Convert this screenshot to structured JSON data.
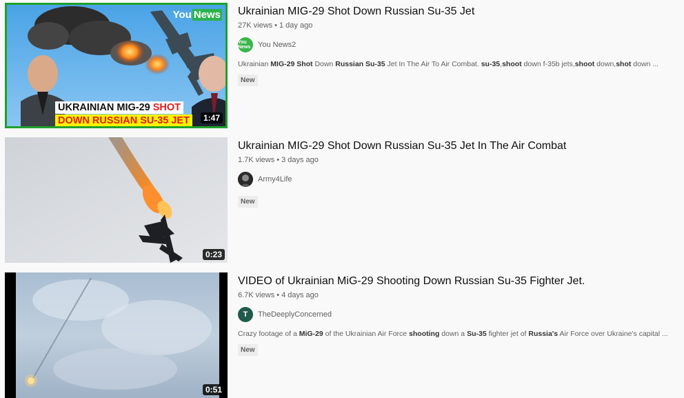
{
  "results": [
    {
      "title": "Ukrainian MIG-29 Shot Down Russian Su-35 Jet",
      "views": "27K views",
      "age": "1 day ago",
      "channel": "You News2",
      "avatar_text": "You News",
      "desc": {
        "parts": [
          {
            "text": "Ukrainian ",
            "bold": false
          },
          {
            "text": "MIG-29 Shot",
            "bold": true
          },
          {
            "text": " Down ",
            "bold": false
          },
          {
            "text": "Russian Su-35",
            "bold": true
          },
          {
            "text": " Jet In The Air To Air Combat. ",
            "bold": false
          },
          {
            "text": "su-35",
            "bold": true
          },
          {
            "text": ",",
            "bold": false
          },
          {
            "text": "shoot",
            "bold": true
          },
          {
            "text": " down f-35b jets,",
            "bold": false
          },
          {
            "text": "shoot",
            "bold": true
          },
          {
            "text": " down,",
            "bold": false
          },
          {
            "text": "shot",
            "bold": true
          },
          {
            "text": " down ...",
            "bold": false
          }
        ]
      },
      "badge": "New",
      "duration": "1:47",
      "thumb_logo_you": "You",
      "thumb_logo_news": "News",
      "thumb_line1_a": "UKRAINIAN MIG-29 ",
      "thumb_line1_b": "SHOT",
      "thumb_line2": "DOWN RUSSIAN SU-35 JET"
    },
    {
      "title": "Ukrainian MIG-29 Shot Down Russian Su-35 Jet In The Air Combat",
      "views": "1.7K views",
      "age": "3 days ago",
      "channel": "Army4Life",
      "badge": "New",
      "duration": "0:23"
    },
    {
      "title": "VIDEO of Ukrainian MiG-29 Shooting Down Russian Su-35 Fighter Jet.",
      "views": "6.7K views",
      "age": "4 days ago",
      "channel": "TheDeeplyConcerned",
      "avatar_text": "T",
      "desc": {
        "parts": [
          {
            "text": "Crazy footage of a ",
            "bold": false
          },
          {
            "text": "MiG-29",
            "bold": true
          },
          {
            "text": " of the Ukrainian Air Force ",
            "bold": false
          },
          {
            "text": "shooting",
            "bold": true
          },
          {
            "text": " down a ",
            "bold": false
          },
          {
            "text": "Su-35",
            "bold": true
          },
          {
            "text": " fighter jet of ",
            "bold": false
          },
          {
            "text": "Russia's",
            "bold": true
          },
          {
            "text": " Air Force over Ukraine's capital ...",
            "bold": false
          }
        ]
      },
      "badge": "New",
      "duration": "0:51"
    }
  ],
  "colors": {
    "title": "#0f0f0f",
    "meta": "#606060",
    "thumb1_border": "#1fa12b",
    "banner_red": "#e21b1b",
    "avatar3": "#1f5a4a"
  }
}
